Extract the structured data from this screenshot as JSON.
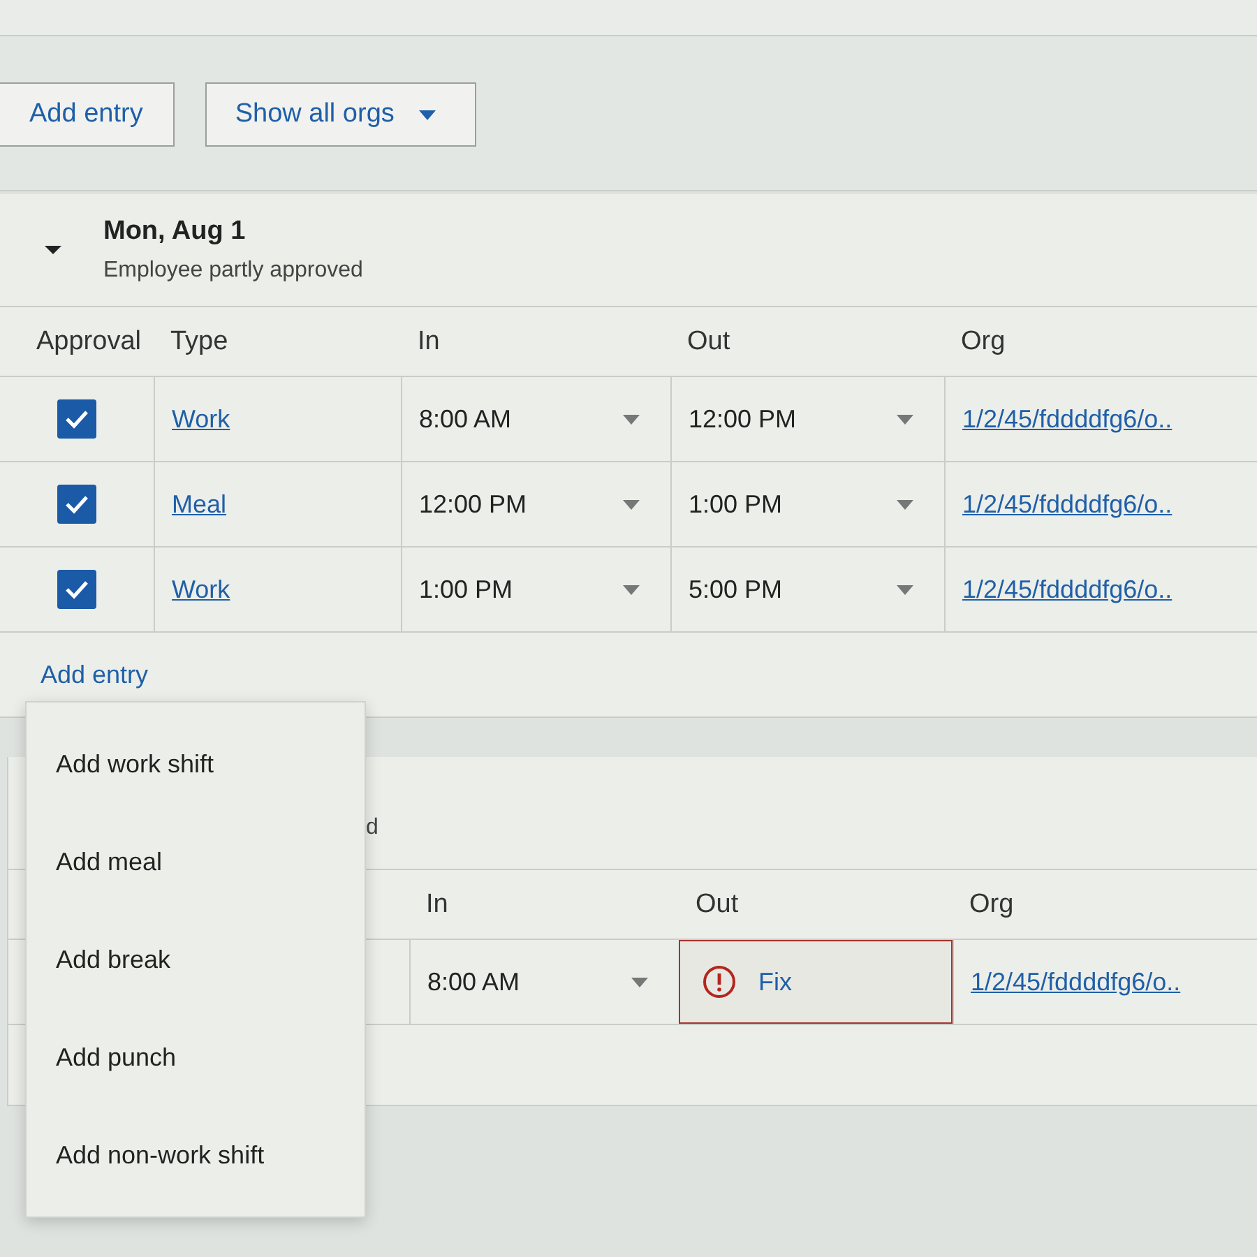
{
  "toolbar": {
    "add_entry_button": "Add entry",
    "org_filter": {
      "label": "Show all orgs"
    }
  },
  "day": {
    "date": "Mon, Aug 1",
    "status": "Employee partly approved",
    "expanded": true,
    "columns": [
      "Approval",
      "Type",
      "In",
      "Out",
      "Org"
    ],
    "rows": [
      {
        "approved": true,
        "type": "Work",
        "in": "8:00 AM",
        "out": {
          "kind": "time",
          "text": "12:00 PM"
        },
        "org": "1/2/45/fddddfg6/o.."
      },
      {
        "approved": true,
        "type": "Meal",
        "in": "12:00 PM",
        "out": {
          "kind": "time",
          "text": "1:00 PM"
        },
        "org": "1/2/45/fddddfg6/o.."
      },
      {
        "approved": true,
        "type": "Work",
        "in": "1:00 PM",
        "out": {
          "kind": "time",
          "text": "5:00 PM"
        },
        "org": "1/2/45/fddddfg6/o.."
      }
    ],
    "add_entry_link": "Add entry"
  },
  "next_day": {
    "status_fragment": "d",
    "columns": [
      "In",
      "Out",
      "Org"
    ],
    "rows": [
      {
        "in": "8:00 AM",
        "out": {
          "kind": "error",
          "text": "Fix"
        },
        "org": "1/2/45/fddddfg6/o.."
      }
    ]
  },
  "menu": {
    "items": [
      "Add work shift",
      "Add meal",
      "Add break",
      "Add punch",
      "Add non-work shift"
    ]
  }
}
